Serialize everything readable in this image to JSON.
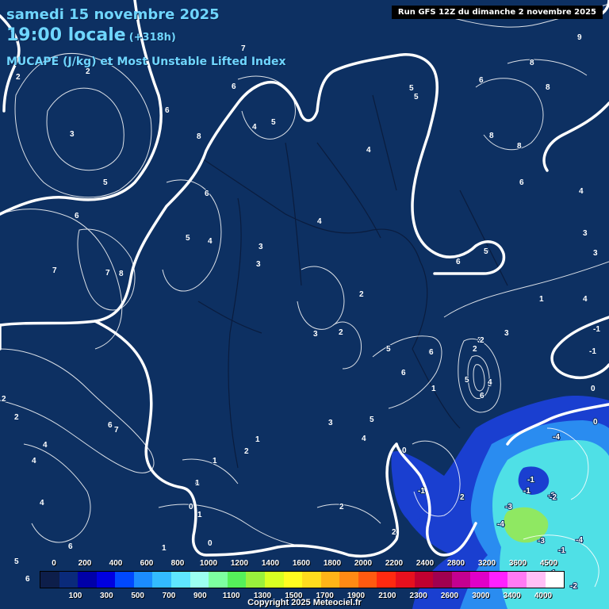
{
  "header": {
    "date": "samedi 15 novembre 2025",
    "time": "19:00 locale",
    "offset": "(+318h)",
    "parameter": "MUCAPE (J/kg) et Most Unstable Lifted Index",
    "run": "Run GFS 12Z du dimanche 2 novembre 2025"
  },
  "legend": {
    "top_labels": [
      "0",
      "200",
      "400",
      "600",
      "800",
      "1000",
      "1200",
      "1400",
      "1600",
      "1800",
      "2000",
      "2200",
      "2400",
      "2800",
      "3200",
      "3600",
      "4500"
    ],
    "bottom_labels": [
      "100",
      "300",
      "500",
      "700",
      "900",
      "1100",
      "1300",
      "1500",
      "1700",
      "1900",
      "2100",
      "2300",
      "2600",
      "3000",
      "3400",
      "4000"
    ],
    "colors": [
      "#0d1e4a",
      "#0a2a7a",
      "#0000a8",
      "#0000e0",
      "#0048ff",
      "#1b8cff",
      "#33bbff",
      "#5fe6ff",
      "#9cfff0",
      "#7dffa0",
      "#55f05a",
      "#9af03c",
      "#d8ff22",
      "#fffc20",
      "#ffdc1e",
      "#ffb418",
      "#ff8a14",
      "#ff5a10",
      "#ff2a10",
      "#e6101e",
      "#c00030",
      "#a00050",
      "#c40090",
      "#e000c8",
      "#ff20ff",
      "#ff7af4",
      "#ffc0f6",
      "#ffffff"
    ]
  },
  "map": {
    "colors": {
      "background": "#0d3062",
      "contour": "#ffffff",
      "zero_line": "#ffffff",
      "cape_low": "#1a3fd0",
      "cape_mid": "#2a8cf0",
      "cape_high": "#4fe0e6",
      "cape_peak": "#8fe862",
      "border": "#0a1c3e"
    },
    "li_labels": [
      "2",
      "3",
      "2",
      "5",
      "6",
      "8",
      "6",
      "7",
      "9",
      "8",
      "8",
      "8",
      "8",
      "4",
      "5",
      "3",
      "3",
      "6",
      "5",
      "4",
      "4",
      "6",
      "4",
      "6",
      "5",
      "4",
      "3",
      "3",
      "6",
      "7",
      "8",
      "7",
      "5",
      "5",
      "6",
      "4",
      "4",
      "2",
      "1",
      "3",
      "2",
      "5",
      "3",
      "6",
      "3",
      "2",
      "5",
      "1",
      "4",
      "1",
      "2",
      "6",
      "7",
      "3",
      "4",
      "3",
      "5",
      "2",
      "6",
      "1",
      "4",
      "1",
      "0",
      "2",
      "2",
      "2",
      "0",
      "1",
      "0",
      "6",
      "4",
      "5",
      "0",
      "2",
      "2",
      "-1",
      "-1",
      "-4",
      "-1",
      "-2",
      "-3",
      "-4",
      "-3",
      "-1",
      "-4",
      "0",
      "-2",
      "-2",
      "-1",
      "-1",
      "-1",
      "5",
      "6",
      "4",
      "1",
      "4",
      "6",
      "5",
      "8",
      "6"
    ]
  },
  "copyright": "Copyright 2025 Meteociel.fr"
}
